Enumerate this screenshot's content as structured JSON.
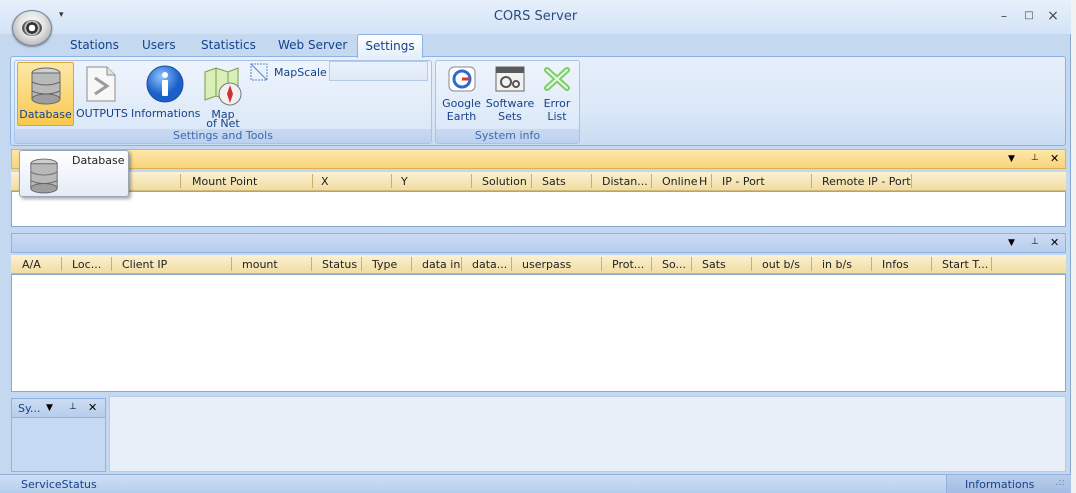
{
  "window": {
    "title": "CORS Server",
    "qat": "▾",
    "minimize": "–",
    "maximize": "□",
    "close": "×"
  },
  "tabs": [
    "Stations",
    "Users",
    "Statistics",
    "Web Server",
    "Settings"
  ],
  "ribbon": {
    "settings_group": {
      "label": "Settings and Tools",
      "buttons": [
        "Database",
        "OUTPUTS",
        "Informations"
      ],
      "map_label_1": "Map",
      "map_label_2": "of Net",
      "mapscale_label": "MapScale",
      "mapscale_value": ""
    },
    "sysinfo_group": {
      "label": "System info",
      "google_1": "Google",
      "google_2": "Earth",
      "software_1": "Software",
      "software_2": "Sets",
      "error_1": "Error",
      "error_2": "List"
    }
  },
  "tooltip": {
    "label": "Database"
  },
  "stations_grid": {
    "columns": [
      "Mount Point",
      "X",
      "Y",
      "Solution",
      "Sats",
      "Distan...",
      "Online",
      "H",
      "IP - Port",
      "Remote IP - Port"
    ]
  },
  "clients_grid": {
    "columns": [
      "A/A",
      "Loc...",
      "Client IP",
      "mount",
      "Status",
      "Type",
      "data in",
      "data...",
      "userpass",
      "Prot...",
      "So...",
      "Sats",
      "out b/s",
      "in b/s",
      "Infos",
      "Start T..."
    ]
  },
  "system_pane": {
    "title": "Sy..."
  },
  "panel_controls": {
    "dropdown": "▼",
    "pin": "⊥",
    "close": "✕"
  },
  "status": {
    "left": "ServiceStatus",
    "right": "Informations",
    "grip": ".::"
  },
  "colors": {
    "accent": "#15428b",
    "ribbon_bg": "#dbe8f8",
    "header_gold": "#f1dda1",
    "active_button": "#f8c94f"
  }
}
